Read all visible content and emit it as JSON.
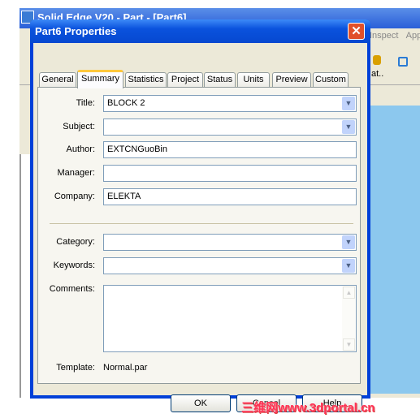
{
  "background_app": {
    "title": "Solid Edge V20 - Part - [Part6]",
    "menu_items": [
      "Inspect",
      "App"
    ],
    "toolbar_text": "at.."
  },
  "dialog": {
    "title": "Part6 Properties",
    "tabs": [
      {
        "label": "General"
      },
      {
        "label": "Summary",
        "selected": true
      },
      {
        "label": "Statistics"
      },
      {
        "label": "Project"
      },
      {
        "label": "Status"
      },
      {
        "label": "Units"
      },
      {
        "label": "Preview"
      },
      {
        "label": "Custom"
      }
    ],
    "fields": {
      "title": {
        "label": "Title:",
        "value": "BLOCK 2"
      },
      "subject": {
        "label": "Subject:",
        "value": ""
      },
      "author": {
        "label": "Author:",
        "value": "EXTCNGuoBin"
      },
      "manager": {
        "label": "Manager:",
        "value": ""
      },
      "company": {
        "label": "Company:",
        "value": "ELEKTA"
      },
      "category": {
        "label": "Category:",
        "value": ""
      },
      "keywords": {
        "label": "Keywords:",
        "value": ""
      },
      "comments": {
        "label": "Comments:",
        "value": ""
      }
    },
    "template": {
      "label": "Template:",
      "value": "Normal.par"
    },
    "buttons": {
      "ok": "OK",
      "cancel": "Cancel",
      "help": "Help"
    }
  },
  "watermark": "三维网www.3dportal.cn",
  "colors": {
    "title_bar": "#0a52dd",
    "selected_tab_accent": "#ffc83c",
    "canvas": "#8cc8ee"
  }
}
